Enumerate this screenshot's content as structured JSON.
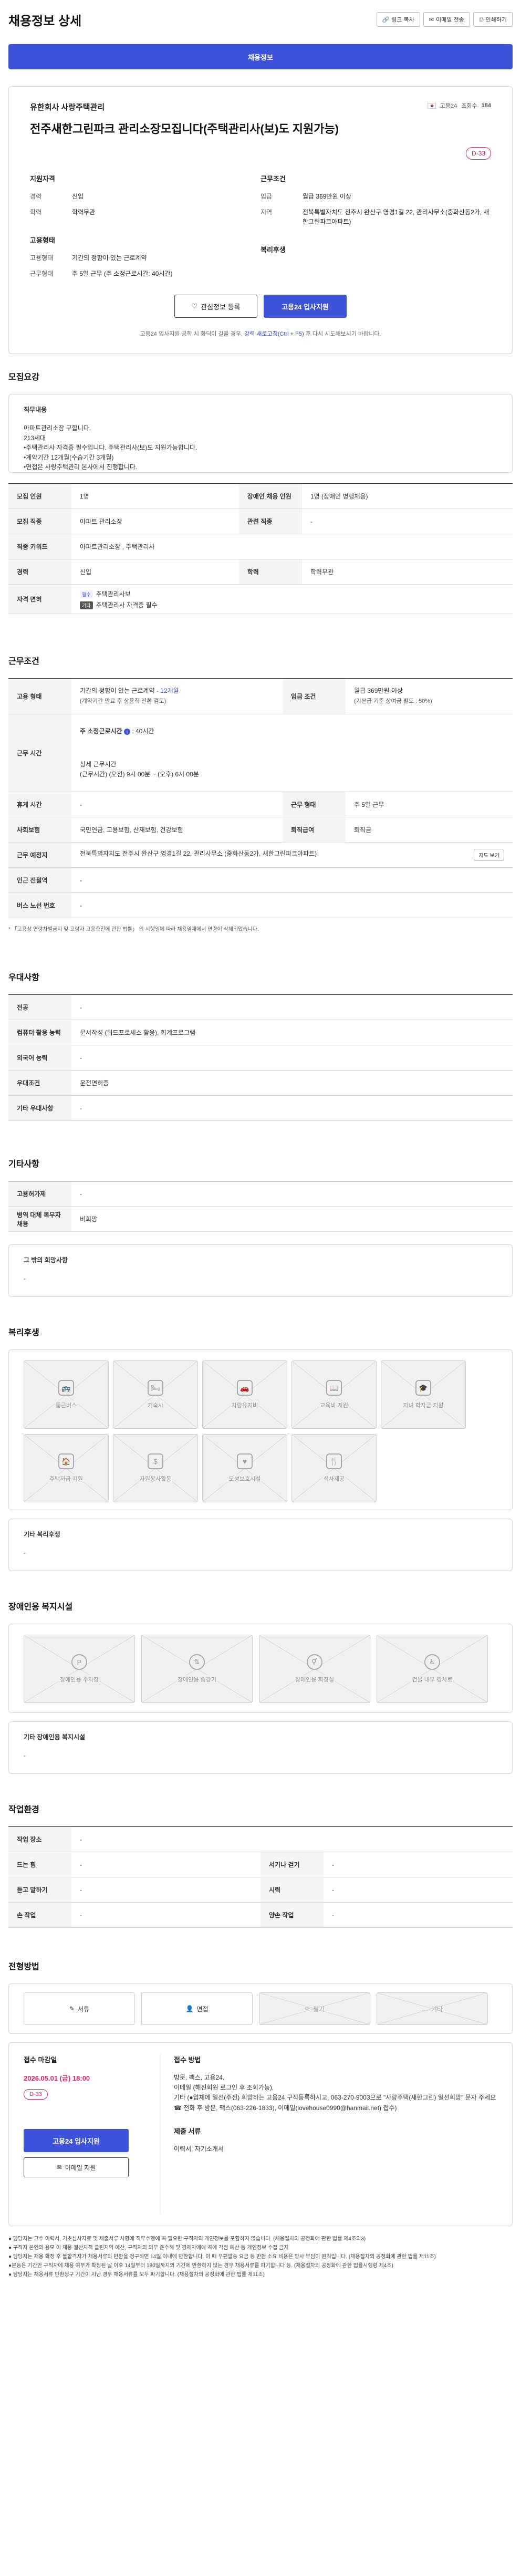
{
  "header": {
    "title": "채용정보 상세",
    "buttons": [
      {
        "icon": "link-icon",
        "label": "링크 복사"
      },
      {
        "icon": "mail-icon",
        "label": "이메일 전송"
      },
      {
        "icon": "print-icon",
        "label": "인쇄하기"
      }
    ]
  },
  "top_banner": {
    "label": "채용정보"
  },
  "summary": {
    "company": "유한회사 사랑주택관리",
    "org_badge": "고용24",
    "views_label": "조회수",
    "views": "184",
    "title": "전주새한그린파크 관리소장모집니다(주택관리사(보)도 지원가능)",
    "dday": "D-33",
    "qualification": {
      "heading": "지원자격",
      "rows": [
        {
          "k": "경력",
          "v": "신입"
        },
        {
          "k": "학력",
          "v": "학력무관"
        }
      ]
    },
    "work_conditions": {
      "heading": "근무조건",
      "rows": [
        {
          "k": "임금",
          "v": "월급 369만원 이상"
        },
        {
          "k": "지역",
          "v": "전북특별자치도 전주시 완산구 영경1길 22, 관리사무소(중화산동2가, 새한그린파크아파트)"
        }
      ]
    },
    "employment": {
      "heading": "고용형태",
      "rows": [
        {
          "k": "고용형태",
          "v": "기간의 정함이 있는 근로계약"
        },
        {
          "k": "근무형태",
          "v": "주 5일 근무 (주 소정근로시간: 40시간)"
        }
      ]
    },
    "welfare_heading": "복리후생",
    "btn_interest": "관심정보 등록",
    "btn_apply": "고용24 입사지원",
    "note_prefix": "고용24 입사지원 공학 시 화딕이 길을 경우,",
    "note_link": "강력 새로고침(Ctrl + F5)",
    "note_suffix": "후 다시 시도해보시기 바랍니다."
  },
  "recruit": {
    "title": "모집요강",
    "duty_label": "직무내용",
    "duty_text": "아파트관리소장 구합니다.\n213세대\n•주택관리사 자격증 필수입니다. 주택관리사(보)도 지원가능합니다.\n•계약기간 12개월(수습기간 3개월)\n•면접은 사랑주택관리 본사에서 진행합니다.",
    "rows": [
      {
        "k1": "모집 인원",
        "v1": "1명",
        "k2": "장애인 채용 인원",
        "v2": "1명 (장애인 병행채용)"
      },
      {
        "k1": "모집 직종",
        "v1": "아파트 관리소장",
        "k2": "관련 직종",
        "v2": "-"
      },
      {
        "k1": "직종 키워드",
        "v1": "아파트관리소장 , 주택관리사",
        "k2": "",
        "v2": ""
      },
      {
        "k1": "경력",
        "v1": "신입",
        "k2": "학력",
        "v2": "학력무관"
      }
    ],
    "license_label": "자격 면허",
    "licenses": [
      {
        "tag": "필수",
        "name": "주택관리사보"
      },
      {
        "tag": "기타",
        "name": "주택관리사 자격증 필수"
      }
    ]
  },
  "conditions": {
    "title": "근무조건",
    "employment_label": "고용 형태",
    "employment_value": "기간의 정함이 있는 근로계약 -",
    "employment_months": "12개월",
    "employment_sub": "(계약기간 만료 후 상용직 전환 검토)",
    "wage_label": "임금 조건",
    "wage_value": "월급 369만원 이상",
    "wage_sub": "(기본급 기준 상여금 별도 : 50%)",
    "hours_label": "근무 시간",
    "hours_main": "주 소정근로시간",
    "hours_value": ": 40시간",
    "hours_detail_head": "상세 근무시간",
    "hours_detail": "(근무시간) (오전) 9시 00분 ~ (오후) 6시 00분",
    "rest_label": "휴게 시간",
    "rest_value": "-",
    "workdays_label": "근무 형태",
    "workdays_value": "주 5일 근무",
    "insurance_label": "사회보험",
    "insurance_value": "국민연금, 고용보험, 산재보험, 건강보험",
    "retire_label": "퇴직급여",
    "retire_value": "퇴직금",
    "place_label": "근무 예정지",
    "place_value": "전북특별자치도 전주시 완산구 영경1길 22, 관리사무소 (중화산동2가, 새한그린파크아파트)",
    "map_btn": "지도 보기",
    "subway_label": "인근 전철역",
    "subway_value": "-",
    "bus_label": "버스 노선 번호",
    "bus_value": "-",
    "footnote": "* 「고용상 연령차별금지 및 고령자 고용촉진에 관한 법률」 의 시행일에 따라 채용영재에서 연령이 삭제되었습니다."
  },
  "preference": {
    "title": "우대사항",
    "rows": [
      {
        "k": "전공",
        "v": "-"
      },
      {
        "k": "컴퓨터 활용 능력",
        "v": "문서작성 (워드프로세스 활용), 회계프로그램"
      },
      {
        "k": "외국어 능력",
        "v": "-"
      },
      {
        "k": "우대조건",
        "v": "운전면허증"
      },
      {
        "k": "기타 우대사항",
        "v": "-"
      }
    ]
  },
  "other": {
    "title": "기타사항",
    "rows": [
      {
        "k": "고용허가제",
        "v": "-"
      },
      {
        "k": "병역 대체 복무자 채용",
        "v": "비희망"
      }
    ],
    "desired_label": "그 밖의 희망사항",
    "desired_value": "-"
  },
  "welfare": {
    "title": "복리후생",
    "items": [
      {
        "icon": "bus-icon",
        "label": "통근버스"
      },
      {
        "icon": "dorm-icon",
        "label": "기숙사"
      },
      {
        "icon": "meal-icon",
        "label": "차량유지비"
      },
      {
        "icon": "book-icon",
        "label": "교육비 지원"
      },
      {
        "icon": "graduation-icon",
        "label": "자녀 학자금 지원"
      },
      {
        "icon": "house-icon",
        "label": "주택자금 지원"
      },
      {
        "icon": "money-icon",
        "label": "자원봉사활동"
      },
      {
        "icon": "care-icon",
        "label": "모성보호시설"
      },
      {
        "icon": "cafeteria-icon",
        "label": "식사제공"
      }
    ],
    "other_label": "기타 복리후생",
    "other_value": "-"
  },
  "disability": {
    "title": "장애인용 복지시설",
    "items": [
      {
        "icon": "parking-icon",
        "label": "장애인용 주차장"
      },
      {
        "icon": "elevator-icon",
        "label": "장애인용 승강기"
      },
      {
        "icon": "restroom-icon",
        "label": "장애인용 화장실"
      },
      {
        "icon": "ramp-icon",
        "label": "건물 내부 경사로"
      }
    ],
    "other_label": "기타 장애인용 복지시설",
    "other_value": "-"
  },
  "environment": {
    "title": "작업환경",
    "rows": [
      {
        "k1": "작업 장소",
        "v1": "-",
        "k2": "",
        "v2": ""
      },
      {
        "k1": "드는 힘",
        "v1": "-",
        "k2": "서기나 걷기",
        "v2": "-"
      },
      {
        "k1": "듣고 말하기",
        "v1": "-",
        "k2": "시력",
        "v2": "-"
      },
      {
        "k1": "손 작업",
        "v1": "-",
        "k2": "양손 작업",
        "v2": "-"
      }
    ]
  },
  "selection": {
    "title": "전형방법",
    "items": [
      {
        "icon": "document-icon",
        "label": "서류",
        "active": true
      },
      {
        "icon": "person-icon",
        "label": "면접",
        "active": true
      },
      {
        "icon": "pencil-icon",
        "label": "필기",
        "active": false
      },
      {
        "icon": "etc-icon",
        "label": "기타",
        "active": false
      }
    ]
  },
  "apply": {
    "deadline_label": "접수 마감일",
    "deadline": "2026.05.01 (금) 18:00",
    "dday": "D-33",
    "btn_apply": "고용24 입사지원",
    "btn_email": "이메일 지원",
    "method_label": "접수 방법",
    "method_text": "방문, 팩스, 고용24,\n이메일 (해진회원 로그인 후 조회가능),\n기타 (●업체에 일선(주전) 희망하는 고용24 구직등록하시고, 063-270-9003으로 \"사랑주택(새한그린) 일선희망\" 문자 주세요 ☎ 전화 후 방문, 팩스(063-226-1833), 이메일(lovehouse0990@hanmail.net) 접수)",
    "docs_label": "제출 서류",
    "docs_text": "이력서, 자기소개서"
  },
  "notes": [
    "● 담당자는 고수 이력서, 기초심사자료 및 제출서류 사항에 직무수행에 꼭 필요한 구직자의 개인정보를 포함하지 않습니다. (채용절차의 공정화에 관한 법률 제4조의3)",
    "● 구직자 본인의 응모 이 채용 결산지적 클린지역 예산, 구직자의 의무 준수해 및 경제자에에 꼭에 각점 예산 등 개인정보 수집 금지",
    "● 담당자는 채용 확정 후 불합격자가 채용서류의 반환을 청구하면 14일 이내에 반환합니다. 이 때 우편발송 요금 등 반환 소요 비용은 당사 부담이 원칙입니다. (채용절차의 공정화에 관한 법률 제11조)",
    "●본등은 기간만 구직자에 채용 여부가 확정된 날 이후 14일부터 180일까지의 기간에 반환하지 않는 경우 채용서류를 파기합니다 등. (채용절차의 공정화에 관한 법률시행령 제4조)",
    "● 담당자는 채용서류 반환청구 기간이 지난 경우 채용서류를 모두 파기합니다. (채용절차의 공정화에 관한 법률 제11조)"
  ]
}
